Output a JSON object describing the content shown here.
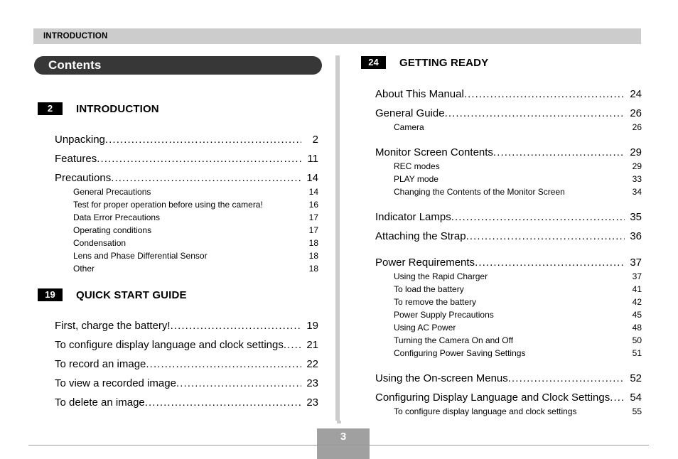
{
  "running_head": {
    "label": "INTRODUCTION"
  },
  "banner": {
    "title": "Contents"
  },
  "footer": {
    "page_number": "3"
  },
  "colors": {
    "running_head_bg": "#cccccc",
    "banner_bg": "#373737",
    "badge_bg": "#000000",
    "divider": "#cccccc",
    "footer_box": "#a0a0a0",
    "footer_rule": "#999999"
  },
  "left_column": {
    "sections": [
      {
        "badge": "2",
        "title": "INTRODUCTION",
        "entries": [
          {
            "level": 1,
            "label": "Unpacking",
            "page": "2"
          },
          {
            "level": 1,
            "label": "Features",
            "page": "11"
          },
          {
            "level": 1,
            "label": "Precautions",
            "page": "14"
          },
          {
            "level": 2,
            "label": "General Precautions",
            "page": "14"
          },
          {
            "level": 2,
            "label": "Test for proper operation before using the camera!",
            "page": "16"
          },
          {
            "level": 2,
            "label": "Data Error Precautions",
            "page": "17"
          },
          {
            "level": 2,
            "label": "Operating conditions",
            "page": "17"
          },
          {
            "level": 2,
            "label": "Condensation",
            "page": "18"
          },
          {
            "level": 2,
            "label": "Lens and Phase Differential Sensor",
            "page": "18"
          },
          {
            "level": 2,
            "label": "Other",
            "page": "18"
          }
        ]
      },
      {
        "badge": "19",
        "title": "QUICK START GUIDE",
        "entries": [
          {
            "level": 1,
            "label": "First, charge the battery!",
            "page": "19"
          },
          {
            "level": 1,
            "label": "To configure display language and clock settings",
            "page": "21"
          },
          {
            "level": 1,
            "label": "To record an image",
            "page": "22"
          },
          {
            "level": 1,
            "label": "To view a recorded image",
            "page": "23"
          },
          {
            "level": 1,
            "label": "To delete an image",
            "page": "23"
          }
        ]
      }
    ]
  },
  "right_column": {
    "sections": [
      {
        "badge": "24",
        "title": "GETTING READY",
        "entries": [
          {
            "level": 1,
            "label": "About This Manual",
            "page": "24"
          },
          {
            "level": 1,
            "label": "General Guide",
            "page": "26"
          },
          {
            "level": 2,
            "label": "Camera",
            "page": "26"
          },
          {
            "level": 1,
            "label": "Monitor Screen Contents",
            "page": "29"
          },
          {
            "level": 2,
            "label": "REC modes",
            "page": "29"
          },
          {
            "level": 2,
            "label": "PLAY mode",
            "page": "33"
          },
          {
            "level": 2,
            "label": "Changing the Contents of the Monitor Screen",
            "page": "34"
          },
          {
            "level": 1,
            "label": "Indicator Lamps",
            "page": "35"
          },
          {
            "level": 1,
            "label": "Attaching the Strap",
            "page": "36"
          },
          {
            "level": 1,
            "label": "Power Requirements",
            "page": "37"
          },
          {
            "level": 2,
            "label": "Using the Rapid Charger",
            "page": "37"
          },
          {
            "level": 2,
            "label": "To load the battery",
            "page": "41"
          },
          {
            "level": 2,
            "label": "To remove the battery",
            "page": "42"
          },
          {
            "level": 2,
            "label": "Power Supply Precautions",
            "page": "45"
          },
          {
            "level": 2,
            "label": "Using AC Power",
            "page": "48"
          },
          {
            "level": 2,
            "label": "Turning the Camera On and Off",
            "page": "50"
          },
          {
            "level": 2,
            "label": "Configuring Power Saving Settings",
            "page": "51"
          },
          {
            "level": 1,
            "label": "Using the On-screen Menus",
            "page": "52"
          },
          {
            "level": 1,
            "label": "Configuring Display Language and Clock Settings",
            "page": "54"
          },
          {
            "level": 2,
            "label": "To configure display language and clock settings",
            "page": "55"
          }
        ]
      }
    ]
  }
}
